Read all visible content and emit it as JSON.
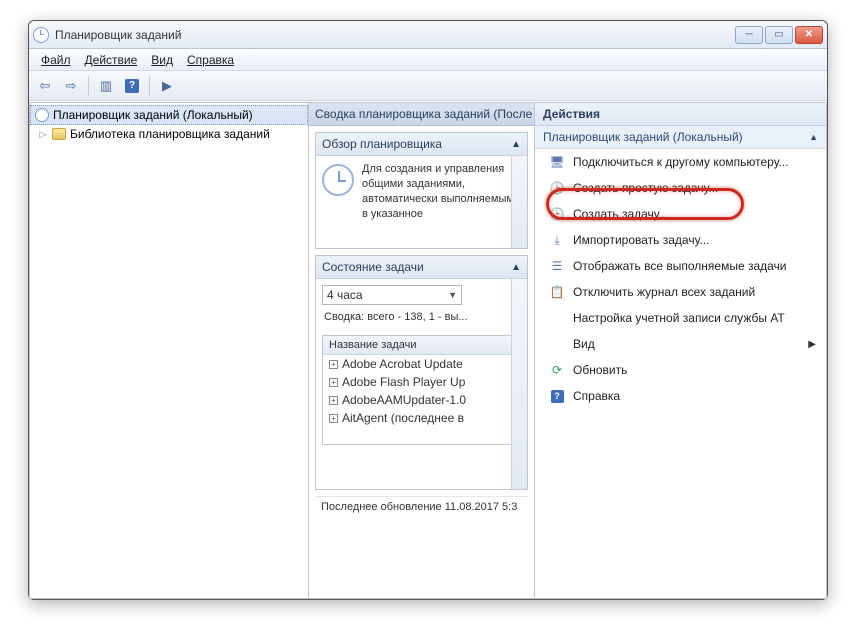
{
  "titlebar": {
    "title": "Планировщик заданий"
  },
  "menubar": {
    "file": "Файл",
    "action": "Действие",
    "view": "Вид",
    "help": "Справка"
  },
  "tree": {
    "root": "Планировщик заданий (Локальный)",
    "library": "Библиотека планировщика заданий"
  },
  "summary": {
    "header": "Сводка планировщика заданий (После",
    "overview_head": "Обзор планировщика",
    "overview_text": "Для создания и управления общими заданиями, автоматически выполняемыми в указанное",
    "status_head": "Состояние задачи",
    "status_combo": "4 часа",
    "status_summary": "Сводка: всего - 138, 1 - вы...",
    "task_list_head": "Название задачи",
    "tasks": [
      "Adobe Acrobat Update",
      "Adobe Flash Player Up",
      "AdobeAAMUpdater-1.0",
      "AitAgent (последнее в"
    ],
    "footer": "Последнее обновление 11.08.2017 5:3"
  },
  "actions": {
    "title": "Действия",
    "subhead": "Планировщик заданий (Локальный)",
    "items": [
      {
        "icon": "link",
        "label": "Подключиться к другому компьютеру..."
      },
      {
        "icon": "clock",
        "label": "Создать простую задачу..."
      },
      {
        "icon": "clock",
        "label": "Создать задачу..."
      },
      {
        "icon": "import",
        "label": "Импортировать задачу..."
      },
      {
        "icon": "list",
        "label": "Отображать все выполняемые задачи"
      },
      {
        "icon": "log",
        "label": "Отключить журнал всех заданий"
      },
      {
        "icon": "blank",
        "label": "Настройка учетной записи службы AT"
      },
      {
        "icon": "view",
        "label": "Вид",
        "submenu": true
      },
      {
        "icon": "refresh",
        "label": "Обновить"
      },
      {
        "icon": "help",
        "label": "Справка"
      }
    ]
  }
}
